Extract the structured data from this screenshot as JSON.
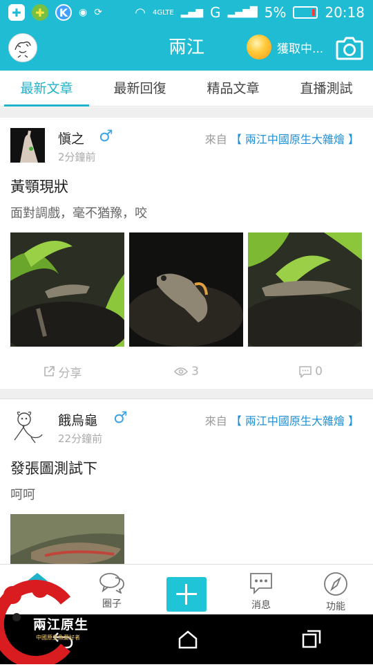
{
  "status_bar": {
    "network": "4GLTE",
    "carrier_g": "G",
    "battery_pct": "5%",
    "time": "20:18"
  },
  "header": {
    "title": "兩江",
    "weather_status": "獲取中..."
  },
  "tabs": [
    {
      "label": "最新文章",
      "active": true
    },
    {
      "label": "最新回復",
      "active": false
    },
    {
      "label": "精品文章",
      "active": false
    },
    {
      "label": "直播測試",
      "active": false
    }
  ],
  "posts": [
    {
      "author": "愼之",
      "gender_symbol": "♂",
      "time": "2分鐘前",
      "from_label": "來自",
      "board": "【 兩江中國原生大雜燴 】",
      "title": "黃顎現狀",
      "snippet": "面對調戲，毫不猶豫，咬",
      "photo_count": 3,
      "share_label": "分享",
      "views": "3",
      "comments": "0"
    },
    {
      "author": "餓烏龜",
      "gender_symbol": "♂",
      "time": "22分鐘前",
      "from_label": "來自",
      "board": "【 兩江中國原生大雜燴 】",
      "title": "發張圖測試下",
      "snippet": "呵呵",
      "photo_count": 1
    }
  ],
  "bottom_nav": {
    "circle_label": "圈子",
    "messages_label": "消息",
    "features_label": "功能"
  },
  "watermark": {
    "text": "兩江原生",
    "sub": "中國原生魚愛好者"
  },
  "colors": {
    "brand": "#1fbcd3",
    "accent": "#1fb3cb",
    "link": "#1f8fd6",
    "gender": "#3aa4e8"
  }
}
